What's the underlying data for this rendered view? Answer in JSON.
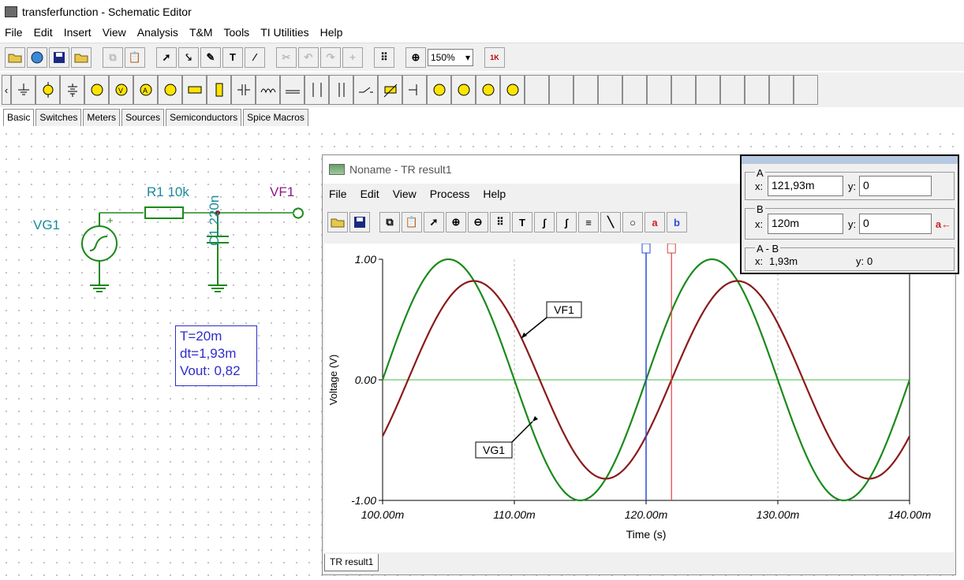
{
  "window": {
    "title": "transferfunction - Schematic Editor"
  },
  "menu": [
    "File",
    "Edit",
    "Insert",
    "View",
    "Analysis",
    "T&M",
    "Tools",
    "TI Utilities",
    "Help"
  ],
  "toolbar": {
    "zoom": "150%",
    "zoom_dropdown_icon": "chevron-down-icon"
  },
  "component_tabs": [
    "Basic",
    "Switches",
    "Meters",
    "Sources",
    "Semiconductors",
    "Spice Macros"
  ],
  "schematic": {
    "r1_label": "R1 10k",
    "c1_label": "C1 220n",
    "vg1_label": "VG1",
    "vf1_label": "VF1",
    "info_lines": [
      "T=20m",
      "dt=1,93m",
      "Vout: 0,82"
    ]
  },
  "tr_window": {
    "title": "Noname - TR result1",
    "menu": [
      "File",
      "Edit",
      "View",
      "Process",
      "Help"
    ],
    "tab": "TR result1"
  },
  "cursor_panel": {
    "a_label": "A",
    "a_x_label": "x:",
    "a_x": "121,93m",
    "a_y_label": "y:",
    "a_y": "0",
    "b_label": "B",
    "b_x_label": "x:",
    "b_x": "120m",
    "b_y_label": "y:",
    "b_y": "0",
    "b_button": "a←",
    "diff_label": "A - B",
    "diff_x_label": "x:",
    "diff_x": "1,93m",
    "diff_y_label": "y:",
    "diff_y": "0"
  },
  "chart_data": {
    "type": "line",
    "xlabel": "Time (s)",
    "ylabel": "Voltage (V)",
    "xlim": [
      100,
      140
    ],
    "ylim": [
      -1.0,
      1.0
    ],
    "x_tick_labels": [
      "100.00m",
      "110.00m",
      "120.00m",
      "130.00m",
      "140.00m"
    ],
    "y_tick_labels": [
      "1.00",
      "0.00",
      "-1.00"
    ],
    "series": [
      {
        "name": "VG1",
        "color": "#1a8a1a",
        "amplitude": 1.0,
        "period_ms": 20,
        "phase_zero_ms": 100,
        "x_ms": [
          100,
          105,
          110,
          115,
          120,
          125,
          130,
          135,
          140
        ],
        "y": [
          0,
          1,
          0,
          -1,
          0,
          1,
          0,
          -1,
          0
        ]
      },
      {
        "name": "VF1",
        "color": "#8b1a1a",
        "amplitude": 0.82,
        "period_ms": 20,
        "phase_zero_ms": 101.93,
        "x_ms": [
          100,
          106.93,
          111.93,
          116.93,
          121.93,
          126.93,
          131.93,
          136.93,
          140
        ],
        "y": [
          -0.47,
          0.82,
          0,
          -0.82,
          0,
          0.82,
          0,
          -0.82,
          -0.47
        ]
      }
    ],
    "cursor_a_ms": 121.93,
    "cursor_b_ms": 120,
    "zero_line_color": "#66cc66",
    "cursor_a_color": "#e04040",
    "cursor_b_color": "#2a4bd8"
  }
}
